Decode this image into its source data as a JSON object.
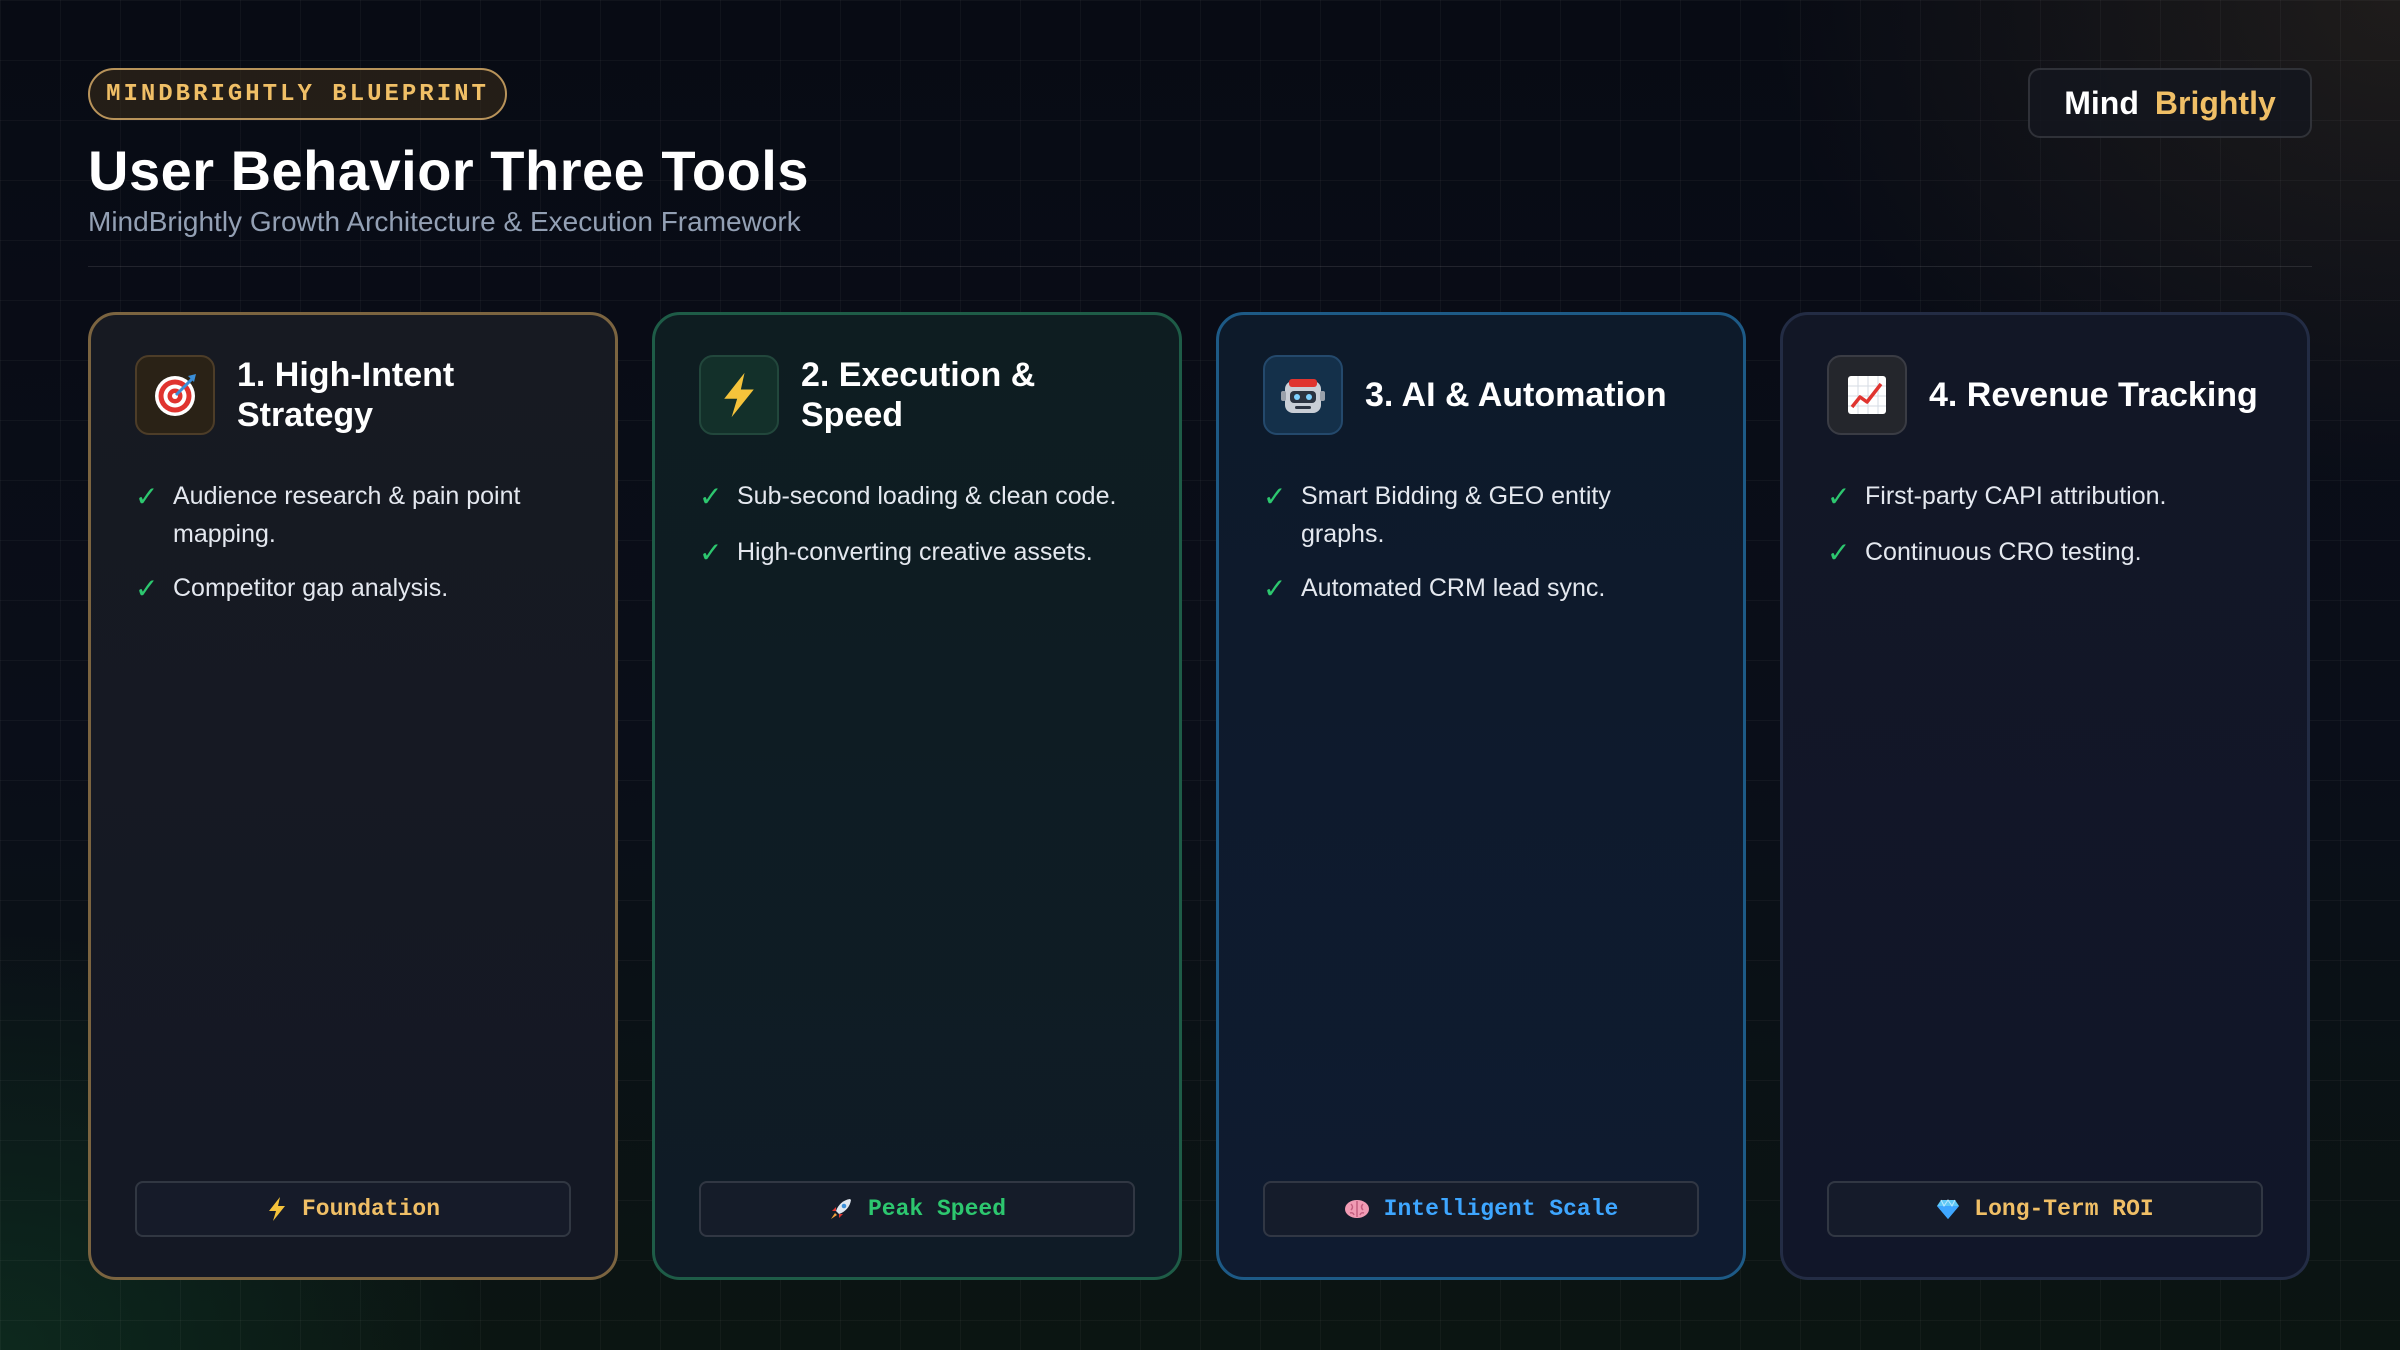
{
  "header": {
    "eyebrow": "MINDBRIGHTLY BLUEPRINT",
    "title": "User Behavior Three Tools",
    "subtitle": "MindBrightly Growth Architecture & Execution Framework"
  },
  "brand": {
    "part1": "Mind",
    "part2": "Brightly"
  },
  "colors": {
    "gold": "#f0bf66",
    "green": "#2dc76f",
    "blue": "#3ea6ff",
    "card1_border": "#7b6440",
    "card2_border": "#1e5c47",
    "card3_border": "#1d5a86",
    "card4_border": "#232c44"
  },
  "cards": [
    {
      "icon": "target-icon",
      "title": "1. High-Intent Strategy",
      "features": [
        "Audience research & pain point mapping.",
        "Competitor gap analysis."
      ],
      "tag_icon": "lightning-icon",
      "tag": "Foundation",
      "tag_color": "#f0bf66"
    },
    {
      "icon": "lightning-icon",
      "title": "2. Execution & Speed",
      "features": [
        "Sub-second loading & clean code.",
        "High-converting creative assets."
      ],
      "tag_icon": "rocket-icon",
      "tag": "Peak Speed",
      "tag_color": "#2dc76f"
    },
    {
      "icon": "robot-icon",
      "title": "3. AI & Automation",
      "features": [
        "Smart Bidding & GEO entity graphs.",
        "Automated CRM lead sync."
      ],
      "tag_icon": "brain-icon",
      "tag": "Intelligent Scale",
      "tag_color": "#3ea6ff"
    },
    {
      "icon": "chart-increasing-icon",
      "title": "4. Revenue Tracking",
      "features": [
        "First-party CAPI attribution.",
        "Continuous CRO testing."
      ],
      "tag_icon": "diamond-icon",
      "tag": "Long-Term ROI",
      "tag_color": "#f0bf66"
    }
  ]
}
